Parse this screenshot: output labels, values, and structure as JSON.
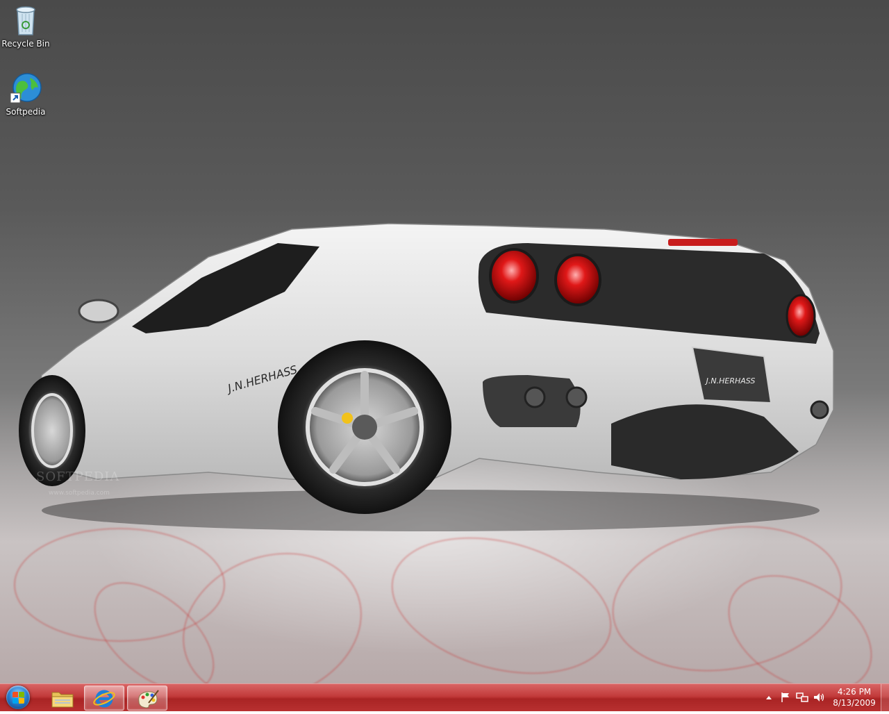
{
  "desktop": {
    "icons": [
      {
        "label": "Recycle Bin",
        "icon": "recycle-bin-icon"
      },
      {
        "label": "Softpedia",
        "icon": "globe-shortcut-icon"
      }
    ],
    "wallpaper": {
      "watermark": "SOFTPEDIA",
      "watermark_url": "www.softpedia.com",
      "car_side_text": "J.N.HERHASS",
      "plate_text": "J.N.HERHASS"
    }
  },
  "taskbar": {
    "color": "#b83030",
    "start_icon": "windows-orb-icon",
    "pinned": [
      {
        "name": "Windows Explorer",
        "icon": "folder-icon",
        "active": false
      },
      {
        "name": "Internet Explorer",
        "icon": "internet-explorer-icon",
        "active": true
      },
      {
        "name": "Personalization",
        "icon": "paint-palette-icon",
        "active": true
      }
    ],
    "tray": {
      "icons": [
        "show-hidden-icons-arrow-icon",
        "action-center-flag-icon",
        "network-icon",
        "volume-icon"
      ]
    },
    "clock": {
      "time": "4:26 PM",
      "date": "8/13/2009"
    }
  }
}
